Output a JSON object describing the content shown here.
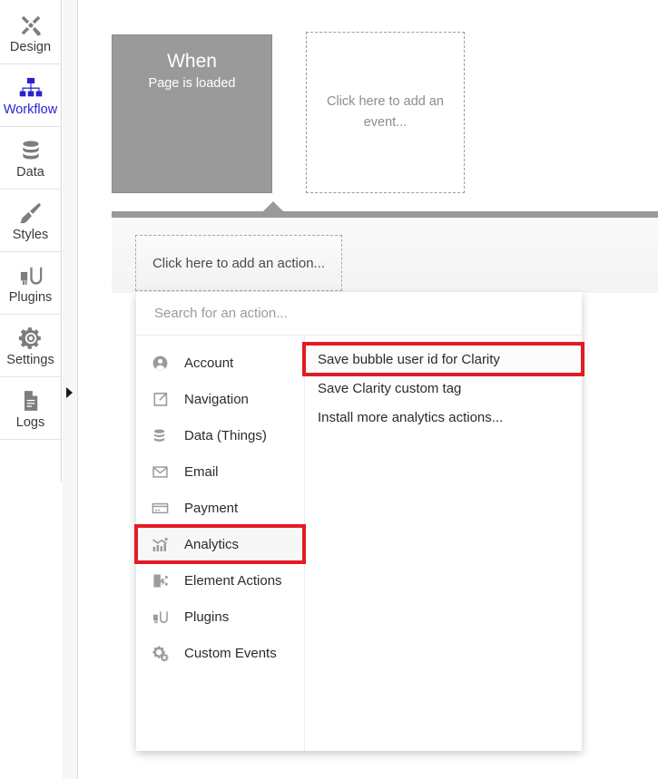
{
  "sidebar": {
    "items": [
      {
        "label": "Design",
        "icon": "design-tools-icon",
        "active": false
      },
      {
        "label": "Workflow",
        "icon": "workflow-tree-icon",
        "active": true
      },
      {
        "label": "Data",
        "icon": "database-icon",
        "active": false
      },
      {
        "label": "Styles",
        "icon": "paintbrush-icon",
        "active": false
      },
      {
        "label": "Plugins",
        "icon": "plug-icon",
        "active": false
      },
      {
        "label": "Settings",
        "icon": "gear-icon",
        "active": false
      },
      {
        "label": "Logs",
        "icon": "document-icon",
        "active": false
      }
    ],
    "expand_arrow": "expand-right-arrow-icon",
    "active_color": "#2a1fd6"
  },
  "workflow": {
    "when_block": {
      "title": "When",
      "subtitle": "Page is loaded"
    },
    "add_event_block": {
      "text": "Click here to add an event..."
    },
    "add_action_block": {
      "text": "Click here to add an action..."
    }
  },
  "action_picker": {
    "search": {
      "placeholder": "Search for an action...",
      "value": ""
    },
    "categories": [
      {
        "label": "Account",
        "icon": "user-circle-icon",
        "highlighted": false
      },
      {
        "label": "Navigation",
        "icon": "share-arrow-icon",
        "highlighted": false
      },
      {
        "label": "Data (Things)",
        "icon": "database-icon",
        "highlighted": false
      },
      {
        "label": "Email",
        "icon": "envelope-icon",
        "highlighted": false
      },
      {
        "label": "Payment",
        "icon": "credit-card-icon",
        "highlighted": false
      },
      {
        "label": "Analytics",
        "icon": "bar-chart-icon",
        "highlighted": true
      },
      {
        "label": "Element Actions",
        "icon": "element-action-icon",
        "highlighted": false
      },
      {
        "label": "Plugins",
        "icon": "plug-icon",
        "highlighted": false
      },
      {
        "label": "Custom Events",
        "icon": "gears-icon",
        "highlighted": false
      }
    ],
    "actions": [
      {
        "label": "Save bubble user id for Clarity",
        "highlighted": true
      },
      {
        "label": "Save Clarity custom tag",
        "highlighted": false
      },
      {
        "label": "Install more analytics actions...",
        "highlighted": false
      }
    ],
    "highlight_color": "#e31b23"
  }
}
